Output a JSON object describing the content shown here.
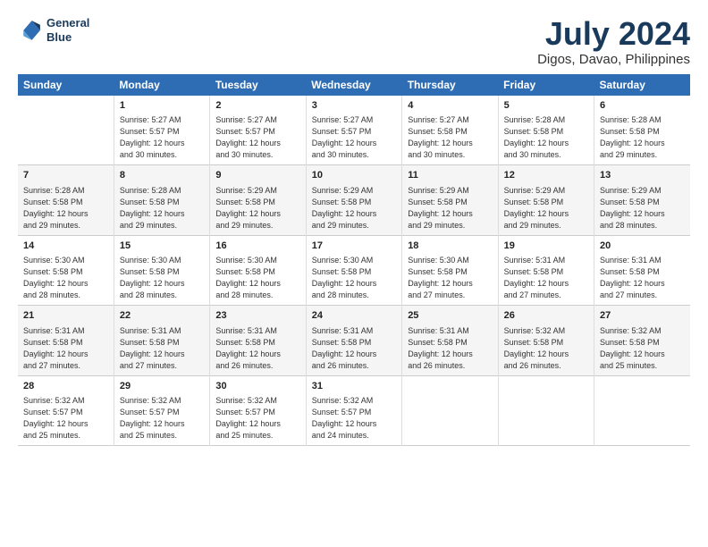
{
  "logo": {
    "line1": "General",
    "line2": "Blue"
  },
  "title": "July 2024",
  "subtitle": "Digos, Davao, Philippines",
  "days_header": [
    "Sunday",
    "Monday",
    "Tuesday",
    "Wednesday",
    "Thursday",
    "Friday",
    "Saturday"
  ],
  "weeks": [
    [
      {
        "day": "",
        "info": ""
      },
      {
        "day": "1",
        "info": "Sunrise: 5:27 AM\nSunset: 5:57 PM\nDaylight: 12 hours\nand 30 minutes."
      },
      {
        "day": "2",
        "info": "Sunrise: 5:27 AM\nSunset: 5:57 PM\nDaylight: 12 hours\nand 30 minutes."
      },
      {
        "day": "3",
        "info": "Sunrise: 5:27 AM\nSunset: 5:57 PM\nDaylight: 12 hours\nand 30 minutes."
      },
      {
        "day": "4",
        "info": "Sunrise: 5:27 AM\nSunset: 5:58 PM\nDaylight: 12 hours\nand 30 minutes."
      },
      {
        "day": "5",
        "info": "Sunrise: 5:28 AM\nSunset: 5:58 PM\nDaylight: 12 hours\nand 30 minutes."
      },
      {
        "day": "6",
        "info": "Sunrise: 5:28 AM\nSunset: 5:58 PM\nDaylight: 12 hours\nand 29 minutes."
      }
    ],
    [
      {
        "day": "7",
        "info": "Sunrise: 5:28 AM\nSunset: 5:58 PM\nDaylight: 12 hours\nand 29 minutes."
      },
      {
        "day": "8",
        "info": "Sunrise: 5:28 AM\nSunset: 5:58 PM\nDaylight: 12 hours\nand 29 minutes."
      },
      {
        "day": "9",
        "info": "Sunrise: 5:29 AM\nSunset: 5:58 PM\nDaylight: 12 hours\nand 29 minutes."
      },
      {
        "day": "10",
        "info": "Sunrise: 5:29 AM\nSunset: 5:58 PM\nDaylight: 12 hours\nand 29 minutes."
      },
      {
        "day": "11",
        "info": "Sunrise: 5:29 AM\nSunset: 5:58 PM\nDaylight: 12 hours\nand 29 minutes."
      },
      {
        "day": "12",
        "info": "Sunrise: 5:29 AM\nSunset: 5:58 PM\nDaylight: 12 hours\nand 29 minutes."
      },
      {
        "day": "13",
        "info": "Sunrise: 5:29 AM\nSunset: 5:58 PM\nDaylight: 12 hours\nand 28 minutes."
      }
    ],
    [
      {
        "day": "14",
        "info": "Sunrise: 5:30 AM\nSunset: 5:58 PM\nDaylight: 12 hours\nand 28 minutes."
      },
      {
        "day": "15",
        "info": "Sunrise: 5:30 AM\nSunset: 5:58 PM\nDaylight: 12 hours\nand 28 minutes."
      },
      {
        "day": "16",
        "info": "Sunrise: 5:30 AM\nSunset: 5:58 PM\nDaylight: 12 hours\nand 28 minutes."
      },
      {
        "day": "17",
        "info": "Sunrise: 5:30 AM\nSunset: 5:58 PM\nDaylight: 12 hours\nand 28 minutes."
      },
      {
        "day": "18",
        "info": "Sunrise: 5:30 AM\nSunset: 5:58 PM\nDaylight: 12 hours\nand 27 minutes."
      },
      {
        "day": "19",
        "info": "Sunrise: 5:31 AM\nSunset: 5:58 PM\nDaylight: 12 hours\nand 27 minutes."
      },
      {
        "day": "20",
        "info": "Sunrise: 5:31 AM\nSunset: 5:58 PM\nDaylight: 12 hours\nand 27 minutes."
      }
    ],
    [
      {
        "day": "21",
        "info": "Sunrise: 5:31 AM\nSunset: 5:58 PM\nDaylight: 12 hours\nand 27 minutes."
      },
      {
        "day": "22",
        "info": "Sunrise: 5:31 AM\nSunset: 5:58 PM\nDaylight: 12 hours\nand 27 minutes."
      },
      {
        "day": "23",
        "info": "Sunrise: 5:31 AM\nSunset: 5:58 PM\nDaylight: 12 hours\nand 26 minutes."
      },
      {
        "day": "24",
        "info": "Sunrise: 5:31 AM\nSunset: 5:58 PM\nDaylight: 12 hours\nand 26 minutes."
      },
      {
        "day": "25",
        "info": "Sunrise: 5:31 AM\nSunset: 5:58 PM\nDaylight: 12 hours\nand 26 minutes."
      },
      {
        "day": "26",
        "info": "Sunrise: 5:32 AM\nSunset: 5:58 PM\nDaylight: 12 hours\nand 26 minutes."
      },
      {
        "day": "27",
        "info": "Sunrise: 5:32 AM\nSunset: 5:58 PM\nDaylight: 12 hours\nand 25 minutes."
      }
    ],
    [
      {
        "day": "28",
        "info": "Sunrise: 5:32 AM\nSunset: 5:57 PM\nDaylight: 12 hours\nand 25 minutes."
      },
      {
        "day": "29",
        "info": "Sunrise: 5:32 AM\nSunset: 5:57 PM\nDaylight: 12 hours\nand 25 minutes."
      },
      {
        "day": "30",
        "info": "Sunrise: 5:32 AM\nSunset: 5:57 PM\nDaylight: 12 hours\nand 25 minutes."
      },
      {
        "day": "31",
        "info": "Sunrise: 5:32 AM\nSunset: 5:57 PM\nDaylight: 12 hours\nand 24 minutes."
      },
      {
        "day": "",
        "info": ""
      },
      {
        "day": "",
        "info": ""
      },
      {
        "day": "",
        "info": ""
      }
    ]
  ]
}
